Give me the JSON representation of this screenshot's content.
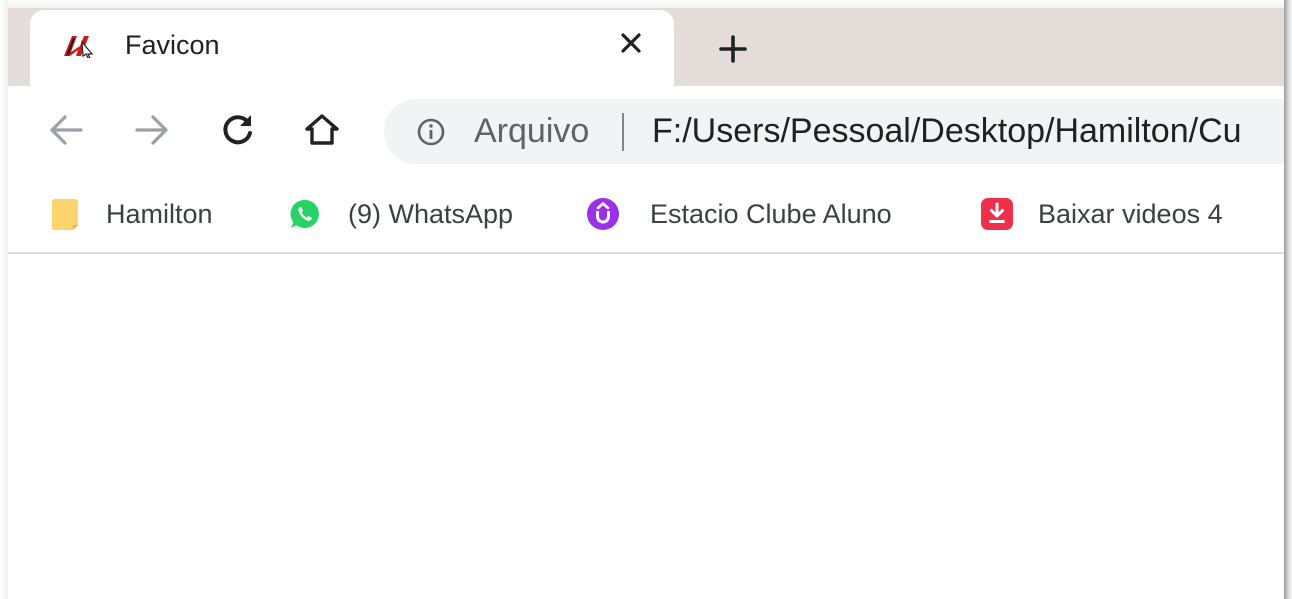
{
  "browser": {
    "tab": {
      "title": "Favicon",
      "favicon": "h-logo-icon",
      "close_icon": "close-icon"
    },
    "new_tab_icon": "plus-icon",
    "toolbar": {
      "back_icon": "arrow-left-icon",
      "forward_icon": "arrow-right-icon",
      "reload_icon": "reload-icon",
      "home_icon": "home-icon",
      "address": {
        "info_icon": "info-icon",
        "scheme_label": "Arquivo",
        "url": "F:/Users/Pessoal/Desktop/Hamilton/Cu"
      }
    },
    "bookmarks": [
      {
        "label": "Hamilton",
        "icon": "folder-icon"
      },
      {
        "label": "(9) WhatsApp",
        "icon": "whatsapp-icon"
      },
      {
        "label": "Estacio Clube Aluno",
        "icon": "estacio-icon"
      },
      {
        "label": "Baixar videos 4",
        "icon": "download-icon"
      }
    ]
  },
  "colors": {
    "tabstrip": "#e3dcd9",
    "omnibox": "#f1f3f4",
    "whatsapp": "#25d366",
    "estacio": "#9b30e8",
    "download": "#f0304a",
    "folder": "#fbd46d"
  }
}
